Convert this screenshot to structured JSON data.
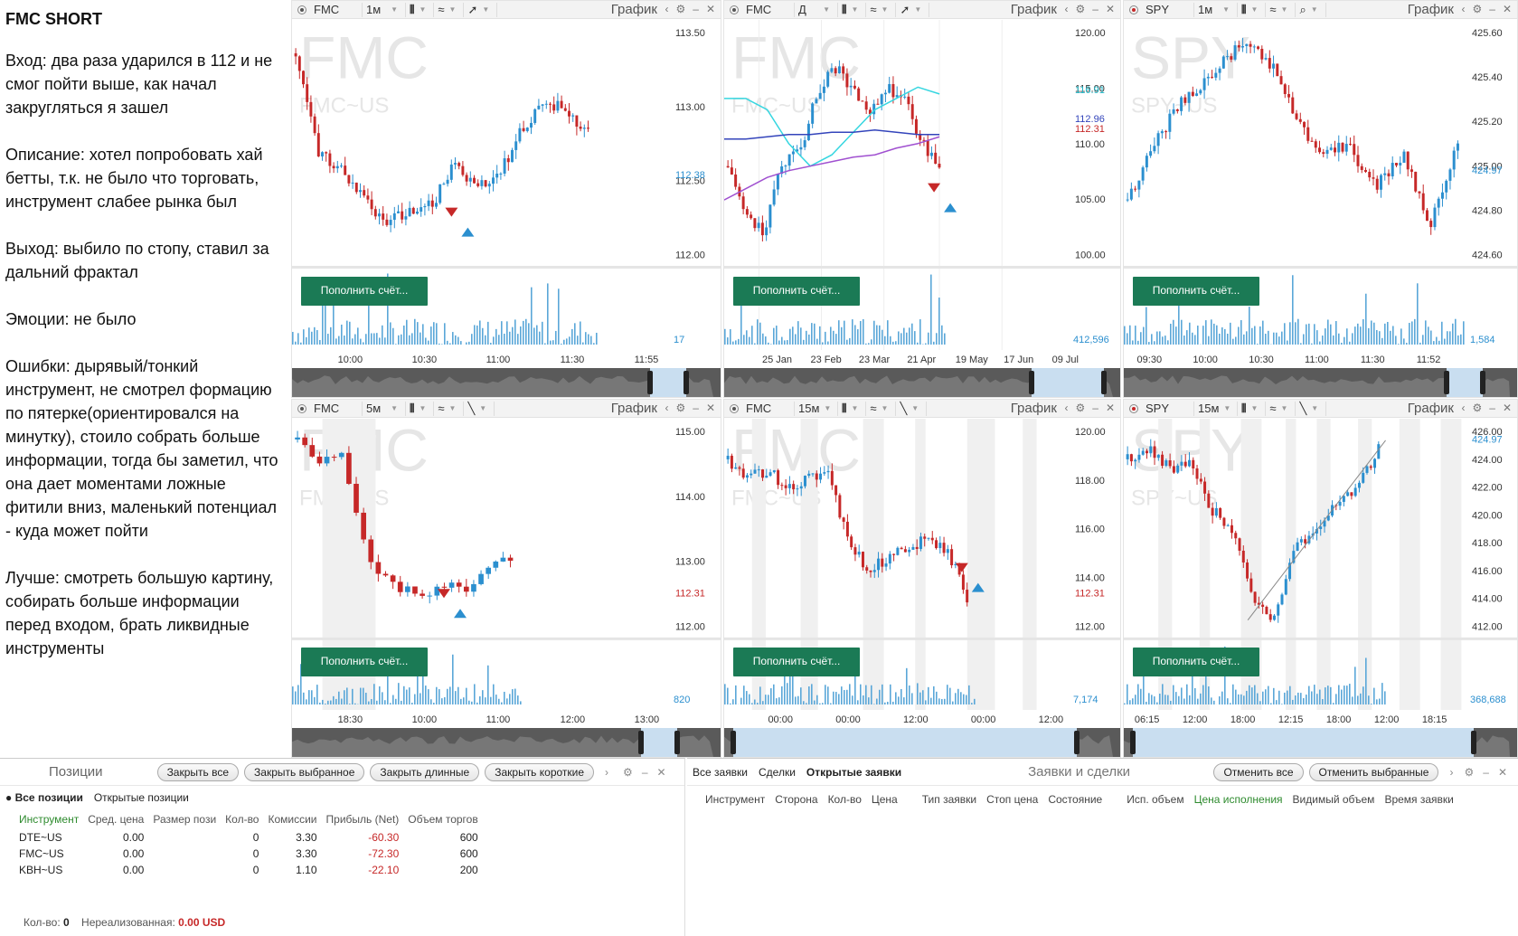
{
  "notes": {
    "title": "FMC SHORT",
    "entry": "Вход: два раза ударился в 112 и не смог пойти выше, как начал закругляться я зашел",
    "description": "Описание: хотел попробовать хай бетты, т.к. не было что торговать, инструмент слабее рынка был",
    "exit": "Выход: выбило по стопу, ставил за дальний фрактал",
    "emotions": "Эмоции: не было",
    "errors": "Ошибки: дырявый/тонкий инструмент, не смотрел формацию по пятерке(ориентировался на минутку), стоило собрать больше информации, тогда бы заметил, что она дает моментами ложные фитили вниз, маленький потенциал - куда может пойти",
    "better": "Лучше: смотреть большую картину, собирать больше информации перед входом, брать ликвидные инструменты"
  },
  "common": {
    "panel_title": "График",
    "fund_button": "Пополнить счёт..."
  },
  "colors": {
    "up": "#2b8fcf",
    "down": "#c62828",
    "volume": "#5aa7d8",
    "button": "#1b7a55"
  },
  "panels": [
    {
      "symbol": "FMC",
      "tf": "1м",
      "watermark": "FMC",
      "sub": "FMC~US",
      "price_labels": [
        "113.50",
        "113.00",
        "112.50",
        "112.00"
      ],
      "last_price": "112.38",
      "time_labels": [
        "10:00",
        "10:30",
        "11:00",
        "11:30",
        "11:55"
      ],
      "volume_value": "17"
    },
    {
      "symbol": "FMC",
      "tf": "Д",
      "watermark": "FMC",
      "sub": "FMC~US",
      "price_labels": [
        "120.00",
        "115.00",
        "110.00",
        "105.00",
        "100.00"
      ],
      "last_price": "112.31",
      "extra_prices": [
        "116.91",
        "112.96"
      ],
      "time_labels": [
        "25 Jan",
        "23 Feb",
        "23 Mar",
        "21 Apr",
        "19 May",
        "17 Jun",
        "09 Jul"
      ],
      "volume_value": "412,596"
    },
    {
      "symbol": "SPY",
      "tf": "1м",
      "watermark": "SPY",
      "sub": "SPY~US",
      "price_labels": [
        "425.60",
        "425.40",
        "425.20",
        "425.00",
        "424.80",
        "424.60"
      ],
      "last_price": "424.97",
      "time_labels": [
        "09:30",
        "10:00",
        "10:30",
        "11:00",
        "11:30",
        "11:52"
      ],
      "volume_value": "1,584"
    },
    {
      "symbol": "FMC",
      "tf": "5м",
      "watermark": "FMC",
      "sub": "FMC~US",
      "price_labels": [
        "115.00",
        "114.00",
        "113.00",
        "112.00"
      ],
      "last_price": "112.31",
      "time_labels": [
        "18:30",
        "10:00",
        "11:00",
        "12:00",
        "13:00"
      ],
      "volume_value": "820"
    },
    {
      "symbol": "FMC",
      "tf": "15м",
      "watermark": "FMC",
      "sub": "FMC~US",
      "price_labels": [
        "120.00",
        "118.00",
        "116.00",
        "114.00",
        "112.00"
      ],
      "last_price": "112.31",
      "time_labels": [
        "00:00",
        "00:00",
        "12:00",
        "00:00",
        "12:00"
      ],
      "volume_value": "7,174"
    },
    {
      "symbol": "SPY",
      "tf": "15м",
      "watermark": "SPY",
      "sub": "SPY~US",
      "price_labels": [
        "426.00",
        "424.00",
        "422.00",
        "420.00",
        "418.00",
        "416.00",
        "414.00",
        "412.00"
      ],
      "last_price": "424.97",
      "time_labels": [
        "06:15",
        "12:00",
        "18:00",
        "12:15",
        "18:00",
        "12:00",
        "18:15"
      ],
      "volume_value": "368,688"
    }
  ],
  "positions": {
    "title": "Позиции",
    "buttons": [
      "Закрыть все",
      "Закрыть выбранное",
      "Закрыть длинные",
      "Закрыть короткие"
    ],
    "tabs": [
      "Все позиции",
      "Открытые позиции"
    ],
    "columns": [
      "Инструмент",
      "Сред. цена",
      "Размер пози",
      "Кол-во",
      "Комиссии",
      "Прибыль (Net)",
      "Объем торгов"
    ],
    "rows": [
      [
        "DTE~US",
        "0.00",
        "",
        "0",
        "3.30",
        "-60.30",
        "600"
      ],
      [
        "FMC~US",
        "0.00",
        "",
        "0",
        "3.30",
        "-72.30",
        "600"
      ],
      [
        "KBH~US",
        "0.00",
        "",
        "0",
        "1.10",
        "-22.10",
        "200"
      ]
    ],
    "footer_qty_label": "Кол-во:",
    "footer_qty": "0",
    "footer_unreal_label": "Нереализованная:",
    "footer_unreal": "0.00 USD"
  },
  "orders": {
    "tabs": [
      "Все заявки",
      "Сделки",
      "Открытые заявки"
    ],
    "title": "Заявки и сделки",
    "buttons": [
      "Отменить все",
      "Отменить выбранные"
    ],
    "columns": [
      "Инструмент",
      "Сторона",
      "Кол-во",
      "Цена",
      "Тип заявки",
      "Стоп цена",
      "Состояние",
      "Исп. объем",
      "Цена исполнения",
      "Видимый объем",
      "Время заявки"
    ]
  }
}
